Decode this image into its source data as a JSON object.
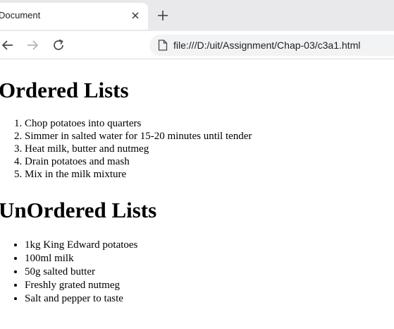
{
  "browser": {
    "tab_title": "Document",
    "url": "file:///D:/uit/Assignment/Chap-03/c3a1.html"
  },
  "page": {
    "ordered_heading": "Ordered Lists",
    "ordered_items": [
      "Chop potatoes into quarters",
      "Simmer in salted water for 15-20 minutes until tender",
      "Heat milk, butter and nutmeg",
      "Drain potatoes and mash",
      "Mix in the milk mixture"
    ],
    "unordered_heading": "UnOrdered Lists",
    "unordered_items": [
      "1kg King Edward potatoes",
      "100ml milk",
      "50g salted butter",
      "Freshly grated nutmeg",
      "Salt and pepper to taste"
    ]
  }
}
